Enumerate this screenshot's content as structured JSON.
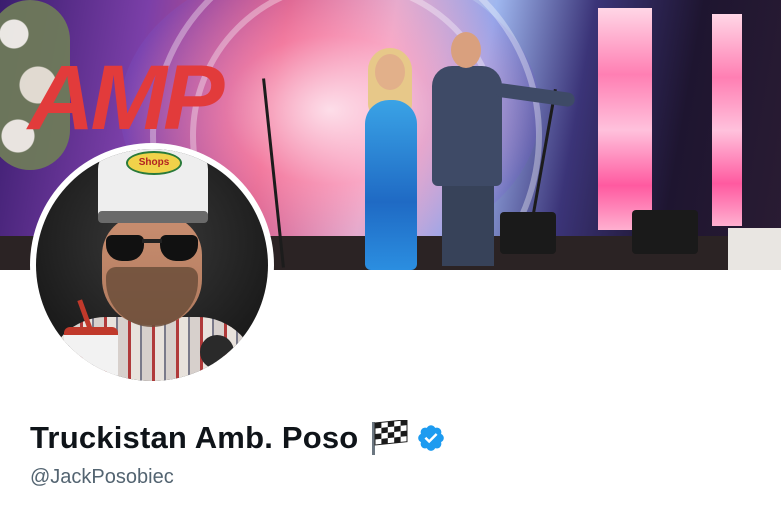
{
  "profile": {
    "display_name": "Truckistan Amb. Poso",
    "handle": "@JackPosobiec",
    "verified": true,
    "name_emoji_icon": "chequered-flag-icon",
    "verified_icon": "verified-badge-icon"
  },
  "banner": {
    "stage_logo_text": "AMP"
  },
  "avatar": {
    "hat_logo_text": "Shops"
  },
  "colors": {
    "verified_blue": "#1d9bf0",
    "name_text": "#0f1419",
    "handle_text": "#536471",
    "background": "#ffffff"
  }
}
